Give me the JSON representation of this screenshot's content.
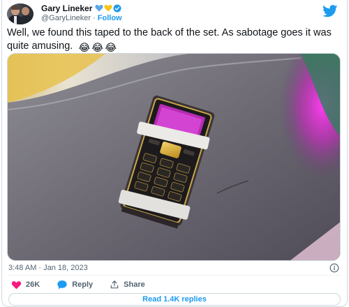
{
  "author": {
    "name": "Gary Lineker",
    "handle": "@GaryLineker",
    "separator": "·",
    "follow_label": "Follow",
    "badge_icons": [
      "blue-heart-icon",
      "yellow-heart-icon",
      "verified-badge-icon"
    ]
  },
  "brand": {
    "icon": "twitter-bird-icon",
    "color": "#1d9bf0"
  },
  "tweet": {
    "text": "Well, we found this taped to the back of the set. As sabotage goes it was quite amusing.",
    "emojis": [
      "😂",
      "😂",
      "😂"
    ]
  },
  "media": {
    "type": "photo",
    "icon": "photo-mobile-phone-taped"
  },
  "meta": {
    "timestamp": "3:48 AM · Jan 18, 2023",
    "info_icon": "info-icon"
  },
  "actions": {
    "likes": {
      "icon": "heart-icon",
      "count": "26K",
      "color": "#f91880"
    },
    "reply": {
      "icon": "reply-bubble-icon",
      "label": "Reply",
      "color": "#1d9bf0"
    },
    "share": {
      "icon": "share-icon",
      "label": "Share"
    }
  },
  "read_replies": {
    "label": "Read 1.4K replies"
  }
}
